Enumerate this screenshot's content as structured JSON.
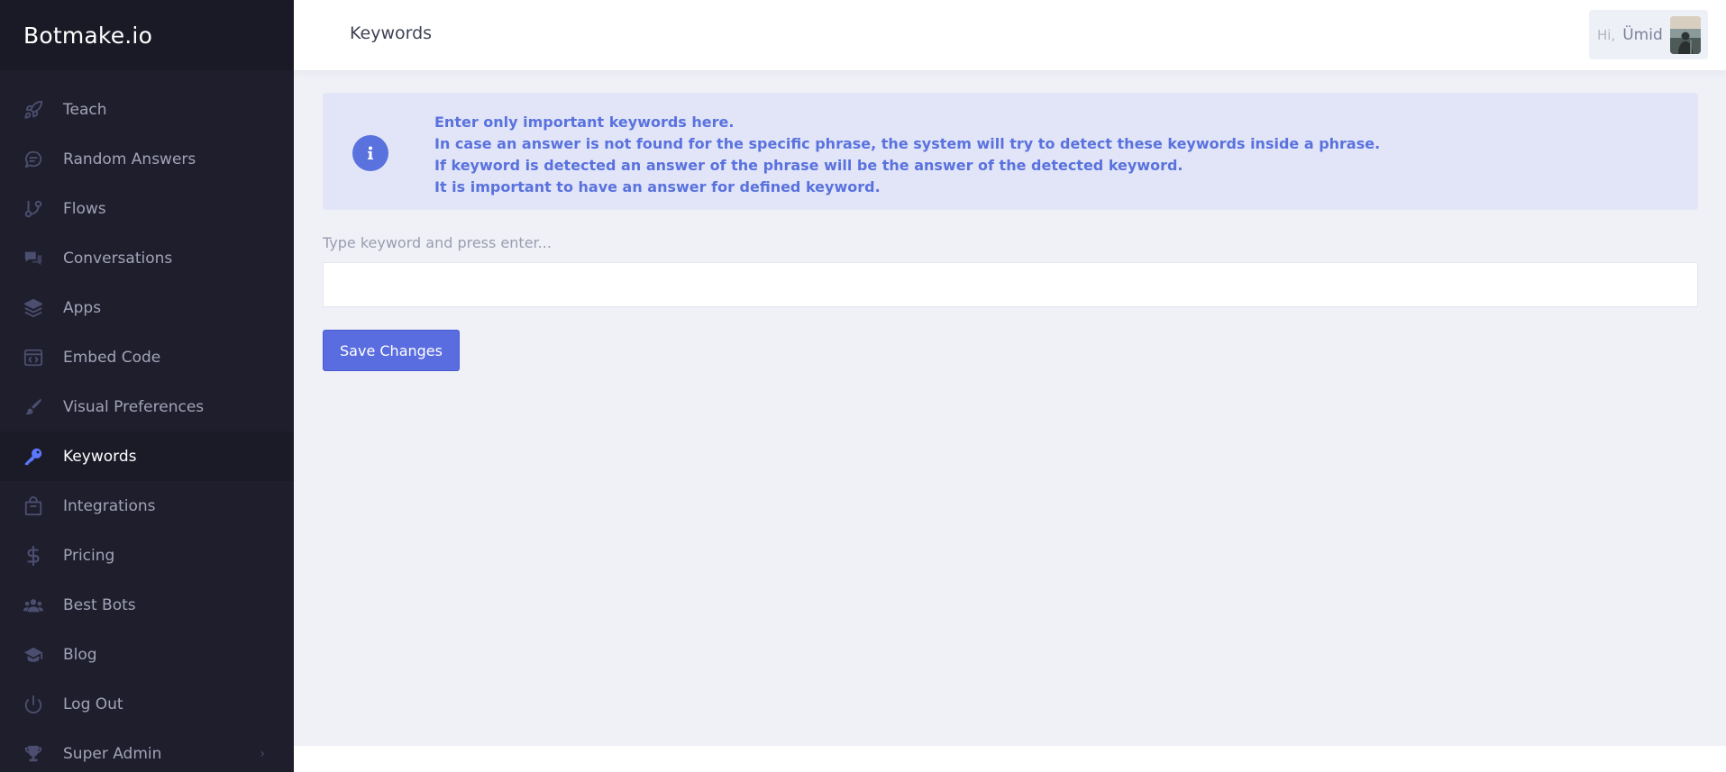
{
  "brand": {
    "name": "Botmake.io"
  },
  "sidebar": {
    "items": [
      {
        "label": "Teach",
        "icon": "rocket-icon",
        "active": false
      },
      {
        "label": "Random Answers",
        "icon": "chat-bubble-icon",
        "active": false
      },
      {
        "label": "Flows",
        "icon": "git-branch-icon",
        "active": false
      },
      {
        "label": "Conversations",
        "icon": "comments-icon",
        "active": false
      },
      {
        "label": "Apps",
        "icon": "layers-icon",
        "active": false
      },
      {
        "label": "Embed Code",
        "icon": "code-window-icon",
        "active": false
      },
      {
        "label": "Visual Preferences",
        "icon": "brush-icon",
        "active": false
      },
      {
        "label": "Keywords",
        "icon": "key-icon",
        "active": true
      },
      {
        "label": "Integrations",
        "icon": "shopping-bag-icon",
        "active": false
      },
      {
        "label": "Pricing",
        "icon": "dollar-icon",
        "active": false
      },
      {
        "label": "Best Bots",
        "icon": "users-icon",
        "active": false
      },
      {
        "label": "Blog",
        "icon": "graduation-cap-icon",
        "active": false
      },
      {
        "label": "Log Out",
        "icon": "power-icon",
        "active": false
      },
      {
        "label": "Super Admin",
        "icon": "trophy-icon",
        "active": false,
        "has_submenu": true
      }
    ]
  },
  "header": {
    "title": "Keywords",
    "greeting": "Hi,",
    "username": "Ümid"
  },
  "alert": {
    "lines": [
      "Enter only important keywords here.",
      "In case an answer is not found for the specific phrase, the system will try to detect these keywords inside a phrase.",
      "If keyword is detected an answer of the phrase will be the answer of the detected keyword.",
      "It is important to have an answer for defined keyword."
    ]
  },
  "form": {
    "label": "Type keyword and press enter...",
    "value": "",
    "save_label": "Save Changes"
  },
  "colors": {
    "sidebar_bg": "#1e1e2d",
    "accent": "#5a6de0",
    "alert_bg": "#e1e5f7",
    "alert_text": "#5a72de"
  }
}
